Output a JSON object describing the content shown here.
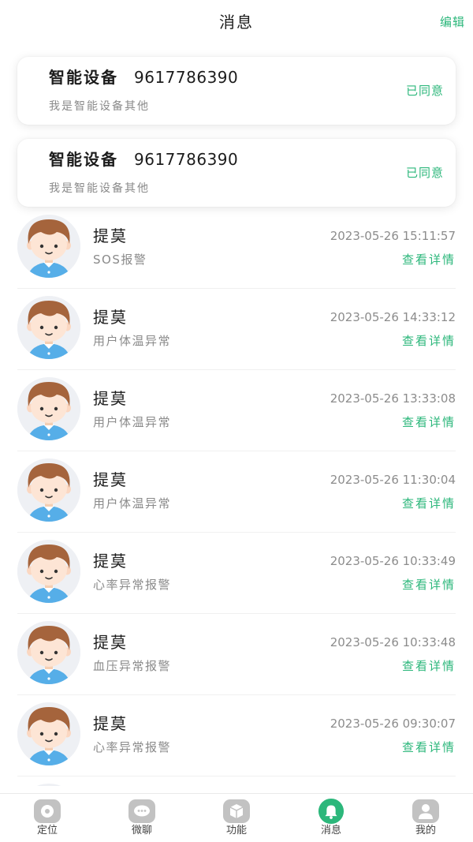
{
  "header": {
    "title": "消息",
    "edit_label": "编辑"
  },
  "device_cards": [
    {
      "name": "智能设备",
      "device_id": "9617786390",
      "description": "我是智能设备其他",
      "status": "已同意"
    },
    {
      "name": "智能设备",
      "device_id": "9617786390",
      "description": "我是智能设备其他",
      "status": "已同意"
    }
  ],
  "messages": [
    {
      "avatar": "cartoon-boy-avatar",
      "name": "提莫",
      "type": "SOS报警",
      "time": "2023-05-26 15:11:57",
      "action": "查看详情"
    },
    {
      "avatar": "cartoon-boy-avatar",
      "name": "提莫",
      "type": "用户体温异常",
      "time": "2023-05-26 14:33:12",
      "action": "查看详情"
    },
    {
      "avatar": "cartoon-boy-avatar",
      "name": "提莫",
      "type": "用户体温异常",
      "time": "2023-05-26 13:33:08",
      "action": "查看详情"
    },
    {
      "avatar": "cartoon-boy-avatar",
      "name": "提莫",
      "type": "用户体温异常",
      "time": "2023-05-26 11:30:04",
      "action": "查看详情"
    },
    {
      "avatar": "cartoon-boy-avatar",
      "name": "提莫",
      "type": "心率异常报警",
      "time": "2023-05-26 10:33:49",
      "action": "查看详情"
    },
    {
      "avatar": "cartoon-boy-avatar",
      "name": "提莫",
      "type": "血压异常报警",
      "time": "2023-05-26 10:33:48",
      "action": "查看详情"
    },
    {
      "avatar": "cartoon-boy-avatar",
      "name": "提莫",
      "type": "心率异常报警",
      "time": "2023-05-26 09:30:07",
      "action": "查看详情"
    }
  ],
  "tab_bar": {
    "items": [
      {
        "label": "定位",
        "icon": "location-icon",
        "active": false
      },
      {
        "label": "微聊",
        "icon": "chat-icon",
        "active": false
      },
      {
        "label": "功能",
        "icon": "cube-icon",
        "active": false
      },
      {
        "label": "消息",
        "icon": "bell-icon",
        "active": true
      },
      {
        "label": "我的",
        "icon": "user-icon",
        "active": false
      }
    ]
  },
  "colors": {
    "accent": "#2cb77b",
    "text_primary": "#1c1c1c",
    "text_secondary": "#8a8a8a",
    "icon_inactive": "#c2c2c2"
  }
}
